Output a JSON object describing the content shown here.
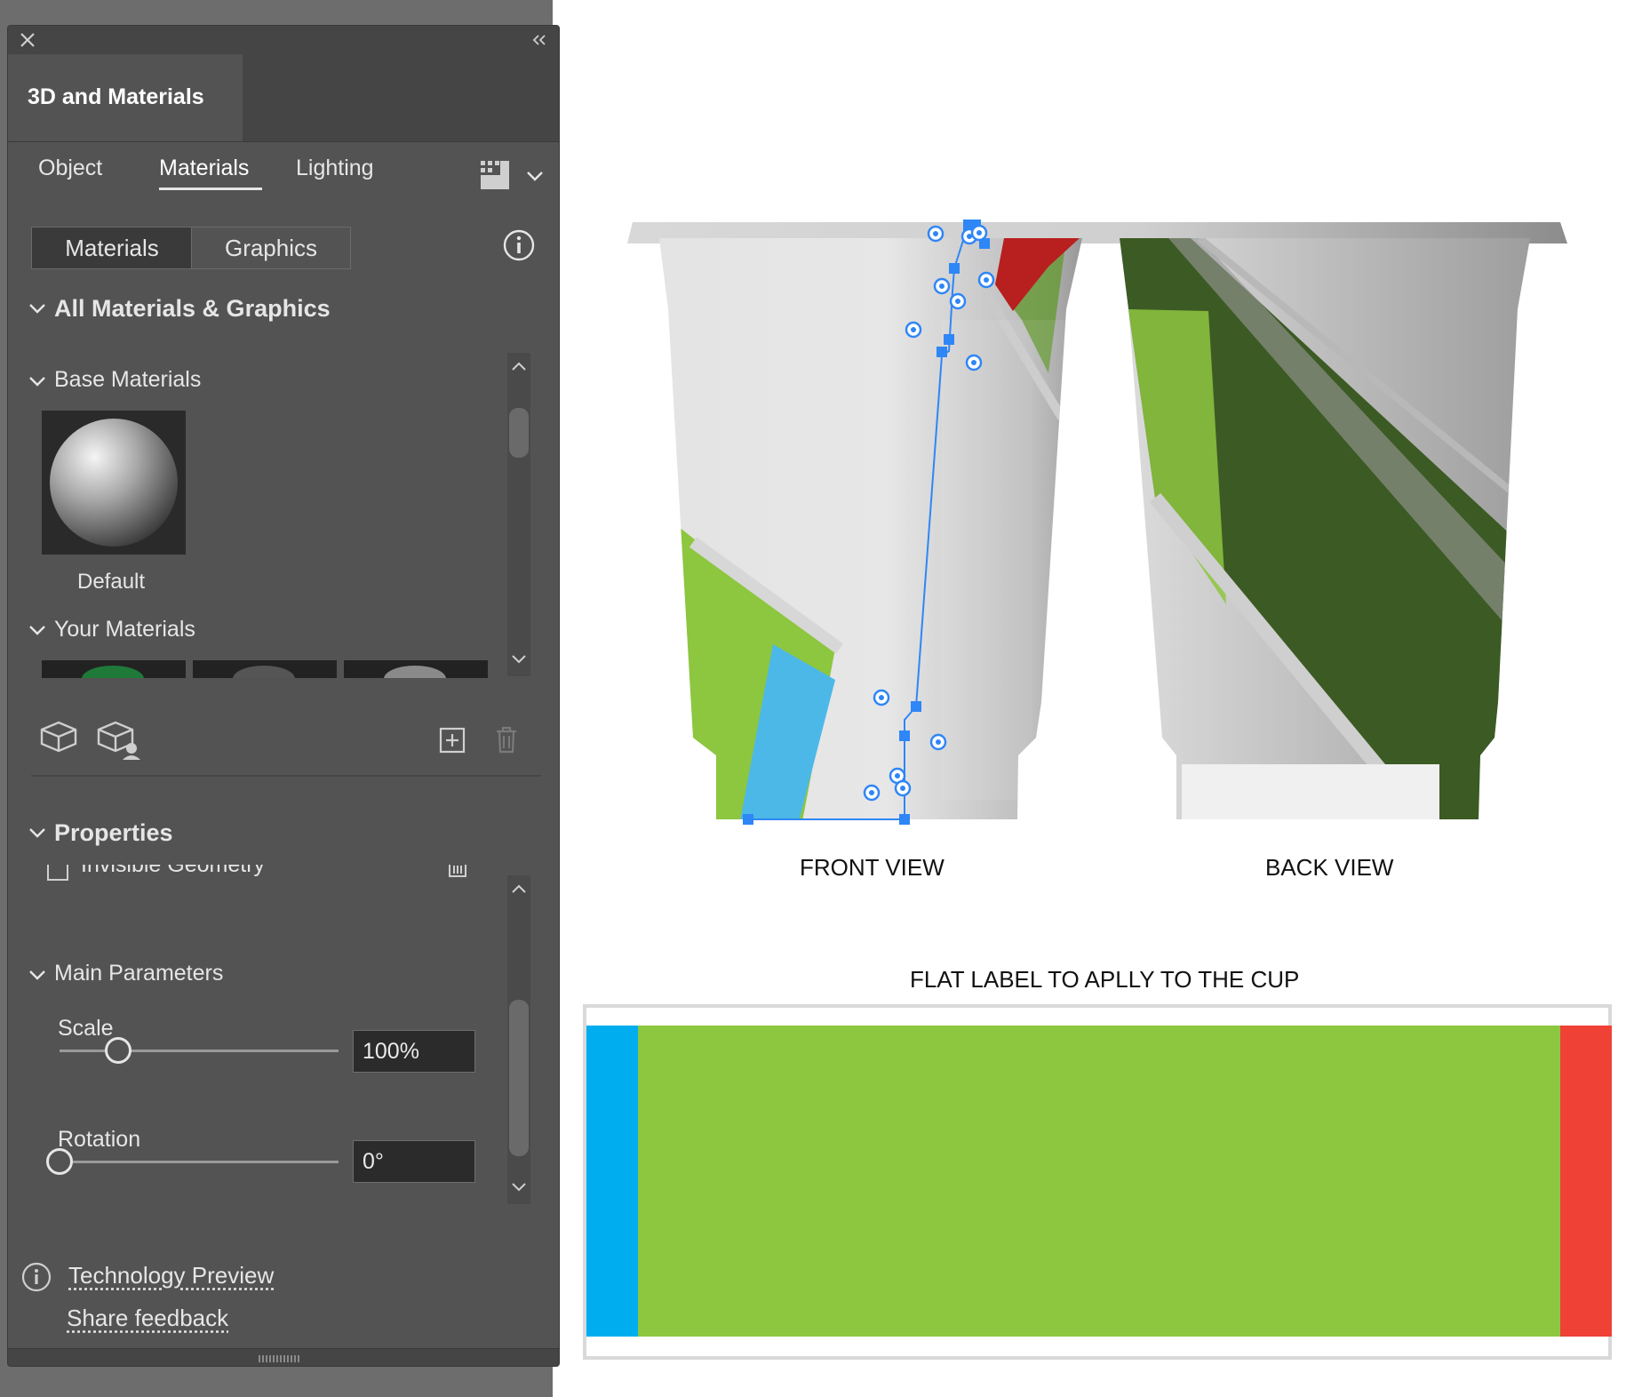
{
  "panel": {
    "title": "3D and Materials",
    "top_tabs": [
      "Object",
      "Materials",
      "Lighting"
    ],
    "active_top_tab": "Materials",
    "segmented": [
      "Materials",
      "Graphics"
    ],
    "active_segment": "Materials",
    "all_section": "All Materials & Graphics",
    "base_section": "Base Materials",
    "base_material_name": "Default",
    "your_section": "Your Materials",
    "properties_section": "Properties",
    "invisible_geometry_label": "Invisible Geometry",
    "main_params_section": "Main Parameters",
    "scale": {
      "label": "Scale",
      "value": "100%",
      "slider_fraction": 0.21
    },
    "rotation": {
      "label": "Rotation",
      "value": "0°",
      "slider_fraction": 0.0
    },
    "tech_preview_link": "Technology Preview",
    "feedback_link": "Share feedback"
  },
  "canvas": {
    "front_caption": "FRONT VIEW",
    "back_caption": "BACK VIEW",
    "flat_label_caption": "FLAT LABEL TO APLLY TO THE CUP",
    "colors": {
      "blue": "#00aeef",
      "green": "#8dc63f",
      "red": "#ef4136",
      "selection": "#2f86f6"
    }
  }
}
